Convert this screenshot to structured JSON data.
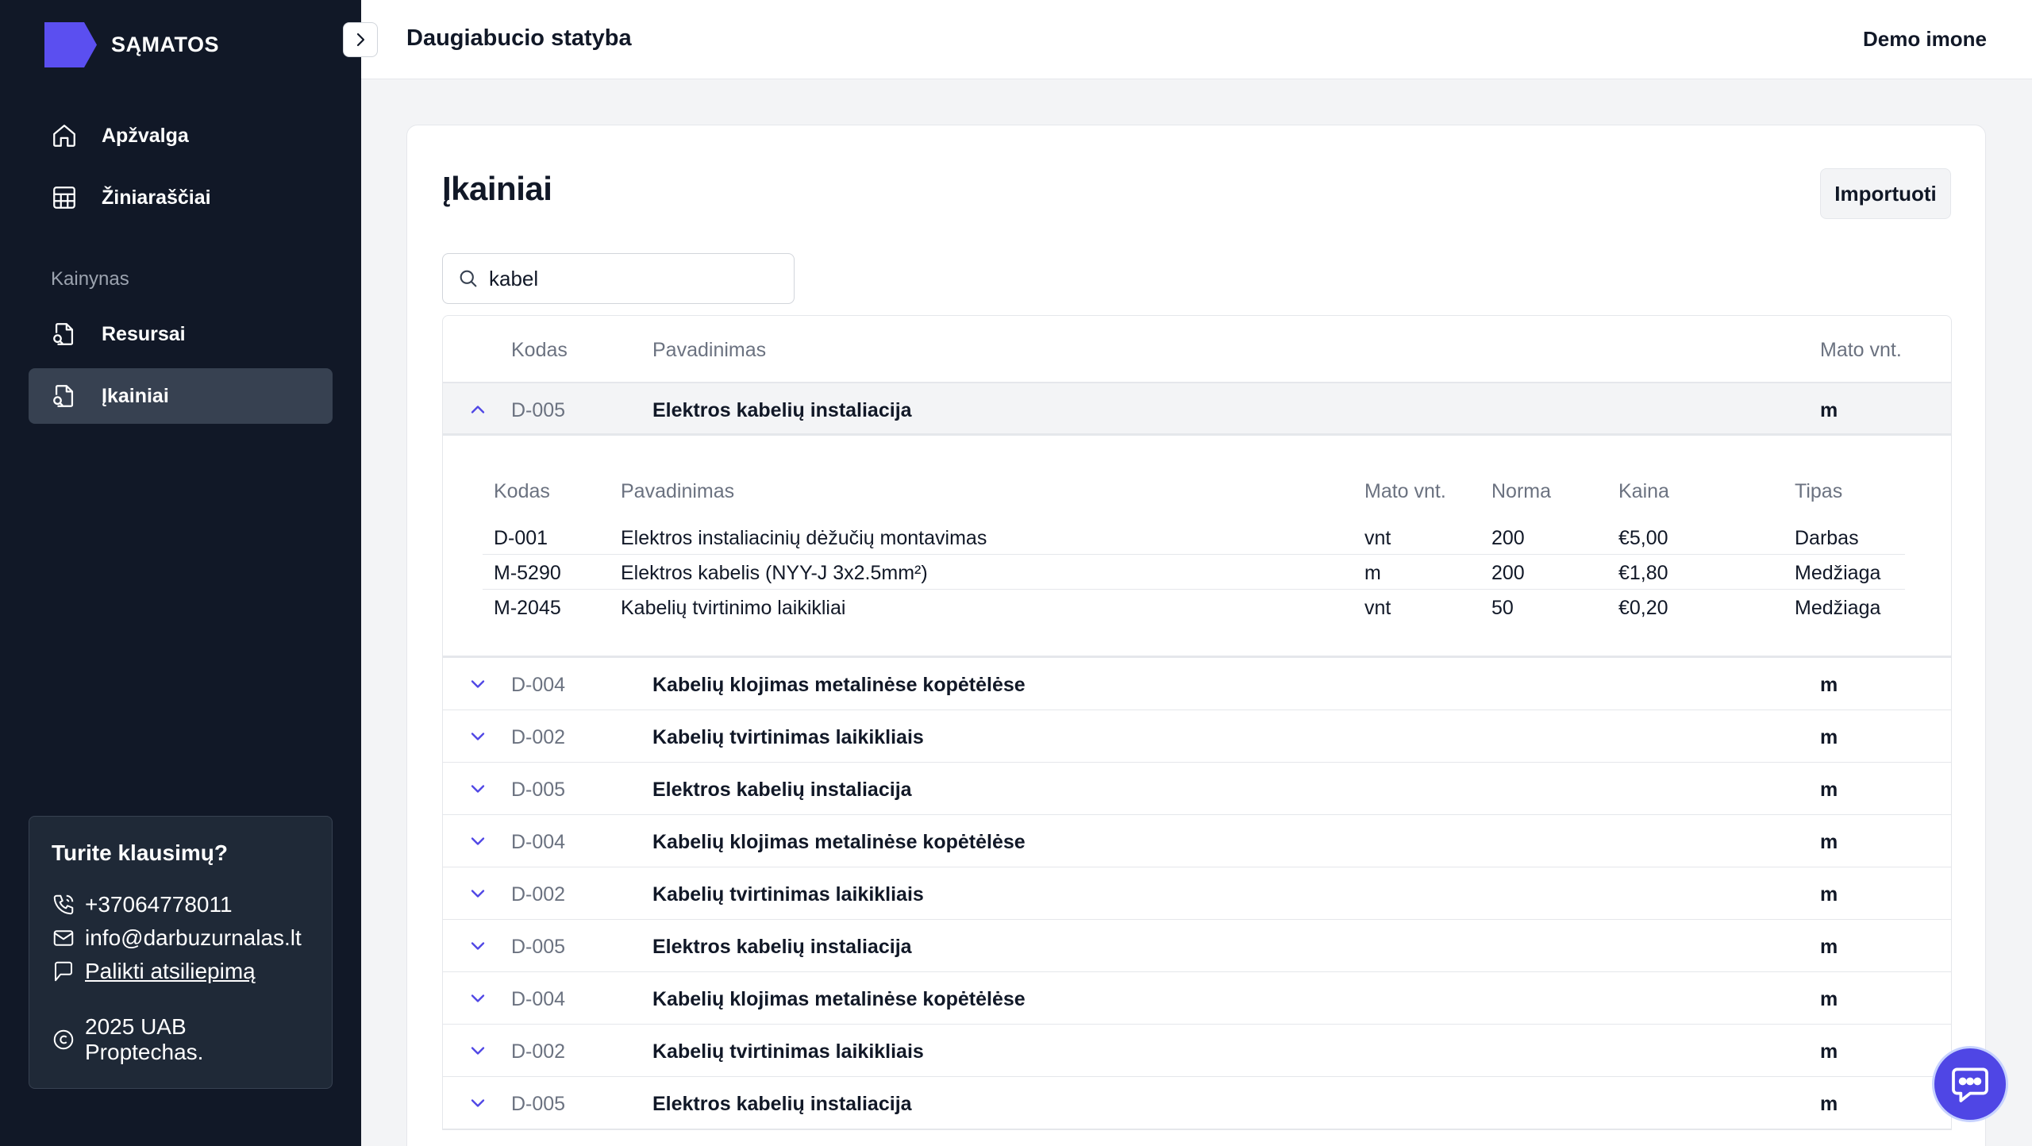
{
  "app": {
    "logo_text": "SĄMATOS",
    "brand_color": "#5b4ff0"
  },
  "sidebar": {
    "nav": [
      {
        "label": "Apžvalga",
        "icon": "home-icon"
      },
      {
        "label": "Žiniaraščiai",
        "icon": "table-icon"
      }
    ],
    "section_label": "Kainynas",
    "section_items": [
      {
        "label": "Resursai",
        "icon": "document-search-icon"
      },
      {
        "label": "Įkainiai",
        "icon": "document-search-icon",
        "active": true
      }
    ],
    "help": {
      "title": "Turite klausimų?",
      "phone": "+37064778011",
      "email": "info@darbuzurnalas.lt",
      "feedback": "Palikti atsiliepimą",
      "copyright": "2025 UAB Proptechas."
    }
  },
  "header": {
    "project": "Daugiabucio statyba",
    "company": "Demo imone"
  },
  "main": {
    "title": "Įkainiai",
    "import_label": "Importuoti",
    "search_value": "kabel",
    "columns": {
      "code": "Kodas",
      "name": "Pavadinimas",
      "unit": "Mato vnt."
    },
    "expanded": {
      "code": "D-005",
      "name": "Elektros kabelių instaliacija",
      "unit": "m",
      "sub_columns": {
        "code": "Kodas",
        "name": "Pavadinimas",
        "unit": "Mato vnt.",
        "norm": "Norma",
        "price": "Kaina",
        "type": "Tipas"
      },
      "sub_rows": [
        {
          "code": "D-001",
          "name": "Elektros instaliacinių dėžučių montavimas",
          "unit": "vnt",
          "norm": "200",
          "price": "€5,00",
          "type": "Darbas"
        },
        {
          "code": "M-5290",
          "name": "Elektros kabelis (NYY-J 3x2.5mm²)",
          "unit": "m",
          "norm": "200",
          "price": "€1,80",
          "type": "Medžiaga"
        },
        {
          "code": "M-2045",
          "name": "Kabelių tvirtinimo laikikliai",
          "unit": "vnt",
          "norm": "50",
          "price": "€0,20",
          "type": "Medžiaga"
        }
      ]
    },
    "rows": [
      {
        "code": "D-004",
        "name": "Kabelių klojimas metalinėse kopėtėlėse",
        "unit": "m"
      },
      {
        "code": "D-002",
        "name": "Kabelių tvirtinimas laikikliais",
        "unit": "m"
      },
      {
        "code": "D-005",
        "name": "Elektros kabelių instaliacija",
        "unit": "m"
      },
      {
        "code": "D-004",
        "name": "Kabelių klojimas metalinėse kopėtėlėse",
        "unit": "m"
      },
      {
        "code": "D-002",
        "name": "Kabelių tvirtinimas laikikliais",
        "unit": "m"
      },
      {
        "code": "D-005",
        "name": "Elektros kabelių instaliacija",
        "unit": "m"
      },
      {
        "code": "D-004",
        "name": "Kabelių klojimas metalinėse kopėtėlėse",
        "unit": "m"
      },
      {
        "code": "D-002",
        "name": "Kabelių tvirtinimas laikikliais",
        "unit": "m"
      },
      {
        "code": "D-005",
        "name": "Elektros kabelių instaliacija",
        "unit": "m"
      }
    ]
  },
  "chat": {
    "icon": "chat-bubble-icon"
  }
}
